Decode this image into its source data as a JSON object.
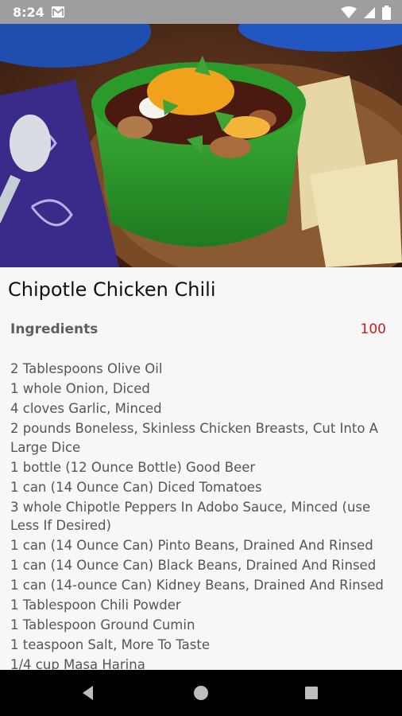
{
  "status_bar": {
    "time": "8:24",
    "left_icons": [
      "gmail-icon"
    ],
    "right_icons": [
      "wifi-icon",
      "signal-icon",
      "battery-icon"
    ]
  },
  "hero": {
    "description_icon": "recipe-photo"
  },
  "recipe": {
    "title": "Chipotle Chicken Chili",
    "section_label": "Ingredients",
    "servings": "100",
    "ingredients": [
      "2 Tablespoons Olive Oil",
      "1 whole Onion, Diced",
      "4 cloves Garlic, Minced",
      "2 pounds Boneless, Skinless Chicken Breasts, Cut Into A Large Dice",
      "1 bottle (12 Ounce Bottle) Good Beer",
      "1 can (14 Ounce Can) Diced Tomatoes",
      "3 whole Chipotle Peppers In Adobo Sauce, Minced (use Less If Desired)",
      "1 can (14 Ounce Can) Pinto Beans, Drained And Rinsed",
      "1 can (14 Ounce Can) Black Beans, Drained And Rinsed",
      "1 can (14-ounce Can) Kidney Beans, Drained And Rinsed",
      "1 Tablespoon Chili Powder",
      "1 Tablespoon Ground Cumin",
      "1 teaspoon Salt, More To Taste",
      "1/4 cup Masa Harina"
    ]
  },
  "colors": {
    "status_bar": "#9e9e9e",
    "servings_accent": "#d11a1a",
    "nav_bar": "#000000"
  },
  "nav_bar": {
    "buttons": [
      "back-icon",
      "home-icon",
      "recents-icon"
    ]
  }
}
